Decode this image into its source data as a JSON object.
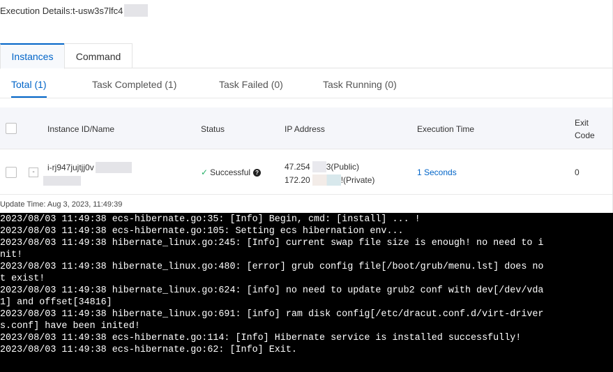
{
  "header": {
    "title_prefix": "Execution Details:t-usw3s7lfc4"
  },
  "tabs": [
    {
      "label": "Instances",
      "active": true
    },
    {
      "label": "Command",
      "active": false
    }
  ],
  "subtabs": [
    {
      "label": "Total (1)",
      "active": true
    },
    {
      "label": "Task Completed (1)",
      "active": false
    },
    {
      "label": "Task Failed (0)",
      "active": false
    },
    {
      "label": "Task Running (0)",
      "active": false
    }
  ],
  "table": {
    "columns": {
      "instance": "Instance ID/Name",
      "status": "Status",
      "ip": "IP Address",
      "exec_time": "Execution Time",
      "exit_code_line1": "Exit",
      "exit_code_line2": "Code"
    },
    "rows": [
      {
        "instance_id": "i-rj947jujtjj0v",
        "status": "Successful",
        "ip_public_prefix": "47.254",
        "ip_public_suffix": "3(Public)",
        "ip_private_prefix": "172.20",
        "ip_private_suffix": "!(Private)",
        "exec_time": "1 Seconds",
        "exit_code": "0"
      }
    ]
  },
  "update_time": "Update Time: Aug 3, 2023, 11:49:39",
  "console": {
    "lines": [
      "2023/08/03 11:49:38 ecs-hibernate.go:35: [Info] Begin, cmd: [install] ... !",
      "2023/08/03 11:49:38 ecs-hibernate.go:105: Setting ecs hibernation env...",
      "2023/08/03 11:49:38 hibernate_linux.go:245: [Info] current swap file size is enough! no need to i",
      "nit!",
      "2023/08/03 11:49:38 hibernate_linux.go:480: [error] grub config file[/boot/grub/menu.lst] does no",
      "t exist!",
      "2023/08/03 11:49:38 hibernate_linux.go:624: [info] no need to update grub2 conf with dev[/dev/vda",
      "1] and offset[34816]",
      "2023/08/03 11:49:38 hibernate_linux.go:691: [info] ram disk config[/etc/dracut.conf.d/virt-driver",
      "s.conf] have been inited!",
      "2023/08/03 11:49:38 ecs-hibernate.go:114: [Info] Hibernate service is installed successfully!",
      "2023/08/03 11:49:38 ecs-hibernate.go:62: [Info] Exit."
    ]
  }
}
